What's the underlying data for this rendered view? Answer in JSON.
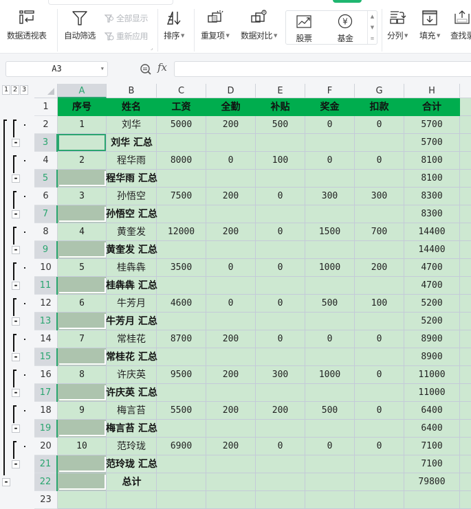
{
  "ribbon": {
    "buttons": [
      {
        "id": "pivot",
        "label": "数据透视表",
        "icon": "pivot-table-icon"
      },
      {
        "id": "autofilter",
        "label": "自动筛选",
        "icon": "filter-icon"
      },
      {
        "id": "sort",
        "label": "排序",
        "icon": "sort-icon",
        "dropdown": true
      },
      {
        "id": "duplicates",
        "label": "重复项",
        "icon": "duplicates-icon",
        "dropdown": true
      },
      {
        "id": "compare",
        "label": "数据对比",
        "icon": "data-compare-icon",
        "dropdown": true
      },
      {
        "id": "split",
        "label": "分列",
        "icon": "split-columns-icon",
        "dropdown": true
      },
      {
        "id": "fill",
        "label": "填充",
        "icon": "fill-icon",
        "dropdown": true
      },
      {
        "id": "findrecord",
        "label": "查找录",
        "icon": "find-record-icon"
      }
    ],
    "small_buttons": [
      {
        "label": "全部显示",
        "icon": "show-all-icon",
        "enabled": false
      },
      {
        "label": "重新应用",
        "icon": "reapply-icon",
        "enabled": false
      }
    ],
    "gallery": [
      {
        "label": "股票",
        "icon": "stock-icon"
      },
      {
        "label": "基金",
        "icon": "fund-icon"
      }
    ],
    "gallery_scroll": [
      "▲",
      "▼",
      "≡"
    ]
  },
  "formula_bar": {
    "name_box": "A3",
    "fx_label": "fx",
    "formula": ""
  },
  "outline": {
    "levels": [
      "1",
      "2",
      "3"
    ]
  },
  "columns": [
    "A",
    "B",
    "C",
    "D",
    "E",
    "F",
    "G",
    "H"
  ],
  "selected_column": "A",
  "table": {
    "header": [
      "序号",
      "姓名",
      "工资",
      "全勤",
      "补贴",
      "奖金",
      "扣款",
      "合计"
    ],
    "rows": [
      {
        "row": "2",
        "type": "data",
        "cells": [
          "1",
          "刘华",
          "5000",
          "200",
          "500",
          "0",
          "0",
          "5700"
        ]
      },
      {
        "row": "3",
        "type": "subtotal",
        "label": "刘华 汇总",
        "total": "5700"
      },
      {
        "row": "4",
        "type": "data",
        "cells": [
          "2",
          "程华雨",
          "8000",
          "0",
          "100",
          "0",
          "0",
          "8100"
        ]
      },
      {
        "row": "5",
        "type": "subtotal",
        "label": "程华雨 汇总",
        "total": "8100"
      },
      {
        "row": "6",
        "type": "data",
        "cells": [
          "3",
          "孙悟空",
          "7500",
          "200",
          "0",
          "300",
          "300",
          "8300"
        ]
      },
      {
        "row": "7",
        "type": "subtotal",
        "label": "孙悟空 汇总",
        "total": "8300"
      },
      {
        "row": "8",
        "type": "data",
        "cells": [
          "4",
          "黄奎发",
          "12000",
          "200",
          "0",
          "1500",
          "700",
          "14400"
        ]
      },
      {
        "row": "9",
        "type": "subtotal",
        "label": "黄奎发 汇总",
        "total": "14400"
      },
      {
        "row": "10",
        "type": "data",
        "cells": [
          "5",
          "桂犇犇",
          "3500",
          "0",
          "0",
          "1000",
          "200",
          "4700"
        ]
      },
      {
        "row": "11",
        "type": "subtotal",
        "label": "桂犇犇 汇总",
        "total": "4700"
      },
      {
        "row": "12",
        "type": "data",
        "cells": [
          "6",
          "牛芳月",
          "4600",
          "0",
          "0",
          "500",
          "100",
          "5200"
        ]
      },
      {
        "row": "13",
        "type": "subtotal",
        "label": "牛芳月 汇总",
        "total": "5200"
      },
      {
        "row": "14",
        "type": "data",
        "cells": [
          "7",
          "常桂花",
          "8700",
          "200",
          "0",
          "0",
          "0",
          "8900"
        ]
      },
      {
        "row": "15",
        "type": "subtotal",
        "label": "常桂花 汇总",
        "total": "8900"
      },
      {
        "row": "16",
        "type": "data",
        "cells": [
          "8",
          "许庆英",
          "9500",
          "200",
          "300",
          "1000",
          "0",
          "11000"
        ]
      },
      {
        "row": "17",
        "type": "subtotal",
        "label": "许庆英 汇总",
        "total": "11000"
      },
      {
        "row": "18",
        "type": "data",
        "cells": [
          "9",
          "梅言苔",
          "5500",
          "200",
          "200",
          "500",
          "0",
          "6400"
        ]
      },
      {
        "row": "19",
        "type": "subtotal",
        "label": "梅言苔 汇总",
        "total": "6400"
      },
      {
        "row": "20",
        "type": "data",
        "cells": [
          "10",
          "范玲珑",
          "6900",
          "200",
          "0",
          "0",
          "0",
          "7100"
        ]
      },
      {
        "row": "21",
        "type": "subtotal",
        "label": "范玲珑 汇总",
        "total": "7100"
      },
      {
        "row": "22",
        "type": "grandtotal",
        "label": "总计",
        "total": "79800"
      },
      {
        "row": "23",
        "type": "empty"
      }
    ]
  },
  "colors": {
    "header_fill": "#00ad4e",
    "cell_fill": "#cde8d1",
    "selection_accent": "#2aa56f",
    "subtotal_A_fill": "#adc4ae",
    "error_triangle": "#127a20"
  }
}
